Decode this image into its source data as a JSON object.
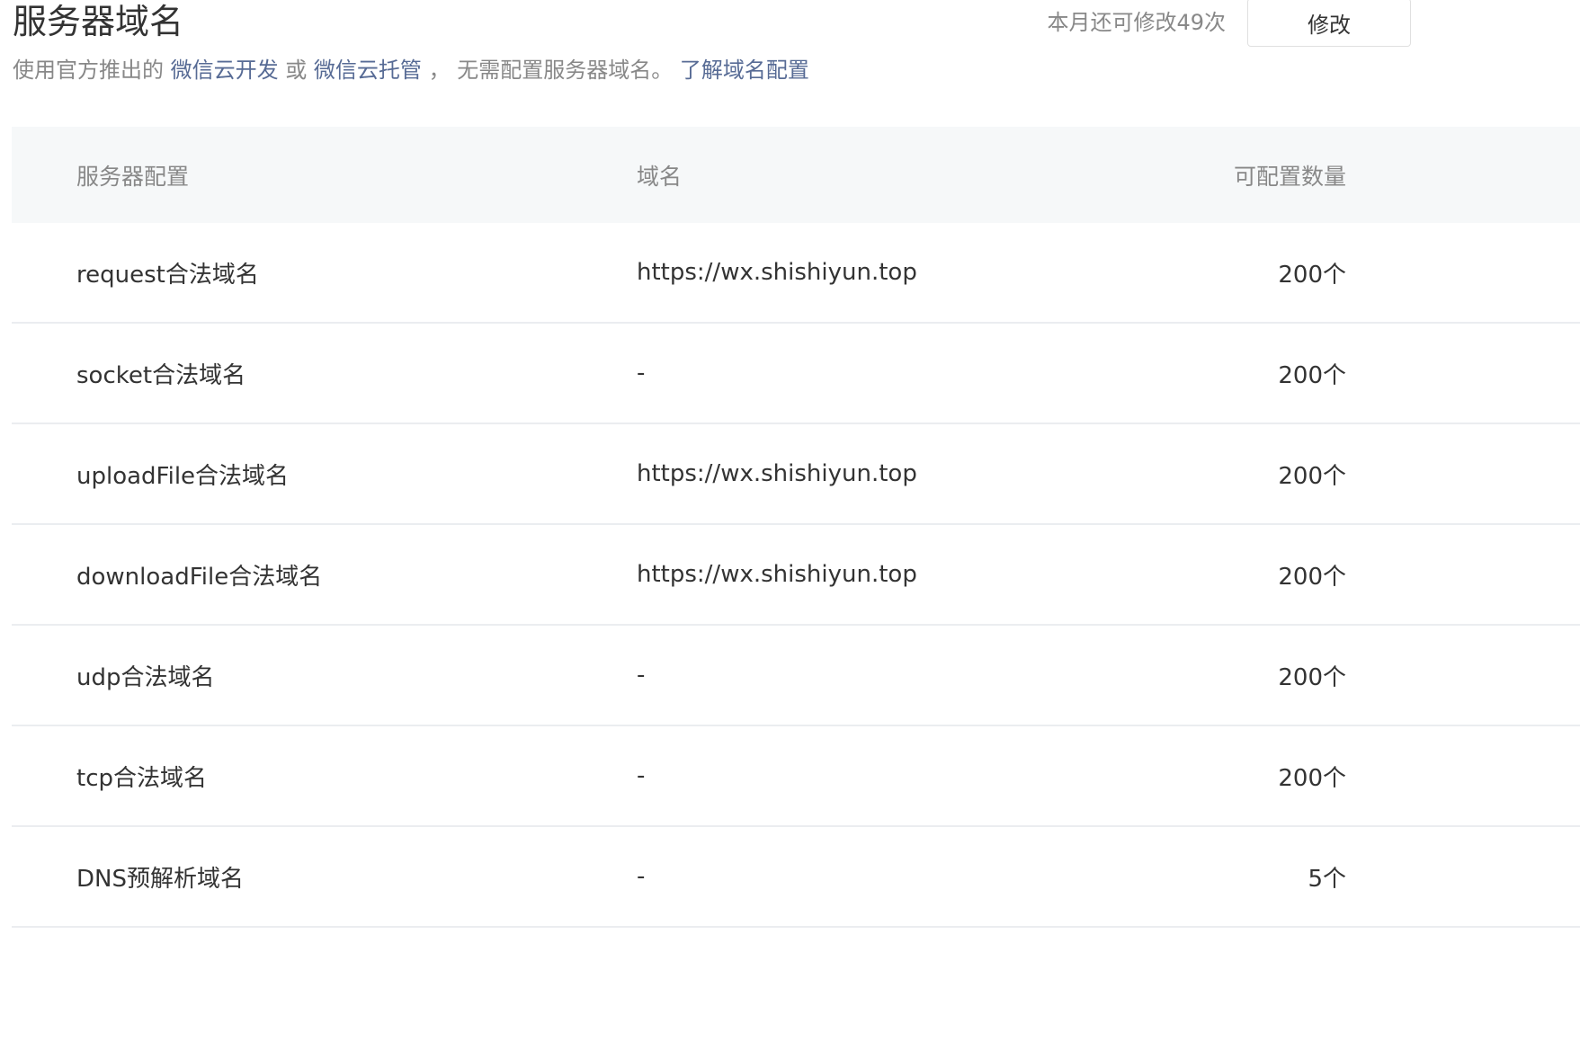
{
  "header": {
    "title": "服务器域名",
    "quota_text": "本月还可修改49次",
    "modify_label": "修改"
  },
  "description": {
    "prefix": "使用官方推出的",
    "link_cloud_dev": "微信云开发",
    "or": "或",
    "link_cloud_hosting": "微信云托管",
    "middle": "，  无需配置服务器域名。",
    "link_learn": "了解域名配置"
  },
  "table": {
    "columns": [
      "服务器配置",
      "域名",
      "可配置数量"
    ],
    "rows": [
      {
        "config": "request合法域名",
        "domain": "https://wx.shishiyun.top",
        "count": "200个"
      },
      {
        "config": "socket合法域名",
        "domain": "-",
        "count": "200个"
      },
      {
        "config": "uploadFile合法域名",
        "domain": "https://wx.shishiyun.top",
        "count": "200个"
      },
      {
        "config": "downloadFile合法域名",
        "domain": "https://wx.shishiyun.top",
        "count": "200个"
      },
      {
        "config": "udp合法域名",
        "domain": "-",
        "count": "200个"
      },
      {
        "config": "tcp合法域名",
        "domain": "-",
        "count": "200个"
      },
      {
        "config": "DNS预解析域名",
        "domain": "-",
        "count": "5个"
      }
    ]
  }
}
